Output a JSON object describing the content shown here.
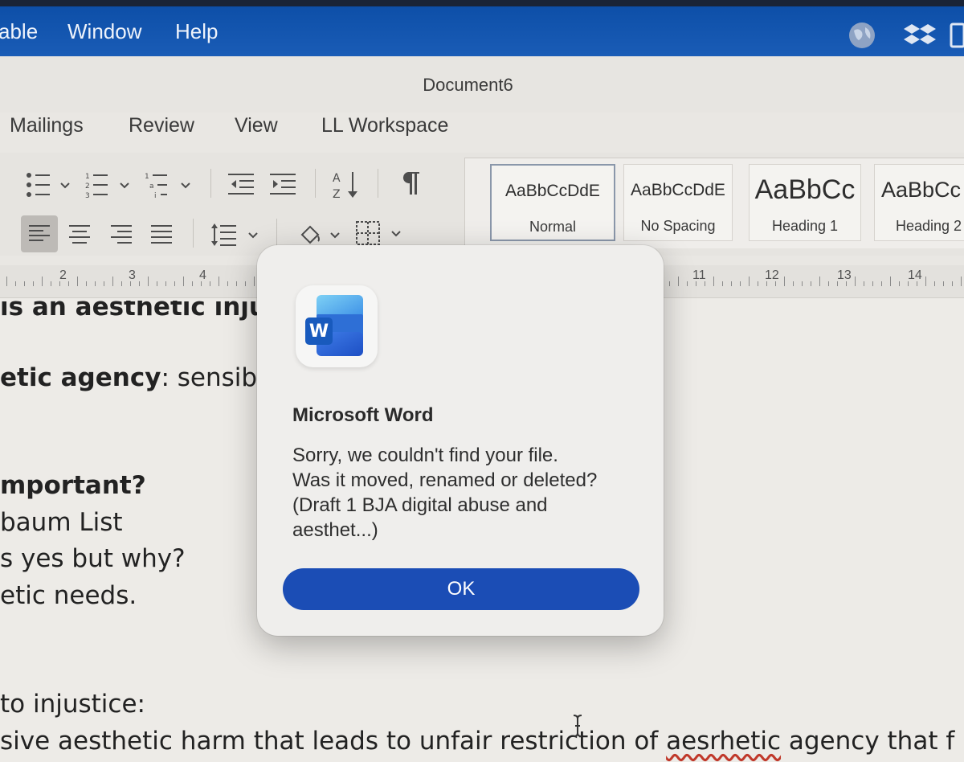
{
  "menubar": {
    "items": [
      "able",
      "Window",
      "Help"
    ],
    "tray_icons": [
      "globe-icon",
      "dropbox-icon",
      "clipboard-icon"
    ]
  },
  "window": {
    "title": "Document6"
  },
  "ribbon": {
    "tabs": [
      "Mailings",
      "Review",
      "View",
      "LL Workspace"
    ],
    "tools": [
      "bullets-icon",
      "numbering-icon",
      "multilevel-list-icon",
      "decrease-indent-icon",
      "increase-indent-icon",
      "sort-icon",
      "show-formatting-icon",
      "align-left-icon",
      "center-icon",
      "align-right-icon",
      "justify-icon",
      "line-spacing-icon",
      "shading-icon",
      "borders-icon"
    ],
    "styles": [
      {
        "sample": "AaBbCcDdE",
        "name": "Normal",
        "selected": true
      },
      {
        "sample": "AaBbCcDdE",
        "name": "No Spacing"
      },
      {
        "sample": "AaBbCc",
        "name": "Heading 1"
      },
      {
        "sample": "AaBbCc",
        "name": "Heading 2"
      }
    ]
  },
  "ruler": {
    "numbers": [
      "2",
      "3",
      "4",
      "11",
      "12",
      "13",
      "14"
    ]
  },
  "document": {
    "lines": [
      {
        "bold": "is an aesthetic inju",
        "rest": ""
      },
      {
        "bold": "etic agency",
        "rest": ": sensib"
      },
      {
        "bold": "mportant?",
        "rest": ""
      },
      {
        "bold": "",
        "rest": "baum List"
      },
      {
        "bold": "",
        "rest": "s yes but why?"
      },
      {
        "bold": "",
        "rest": "etic needs."
      },
      {
        "bold": "",
        "rest": " to injustice:"
      },
      {
        "bold": "",
        "rest": "sive aesthetic harm that leads to unfair restriction of ",
        "misspelled": "aesrhetic",
        "tail": " agency that f"
      }
    ]
  },
  "dialog": {
    "app_icon": "word-app-icon",
    "icon_letter": "W",
    "title": "Microsoft Word",
    "message": "Sorry, we couldn't find your file.\nWas it moved, renamed or deleted?\n(Draft 1 BJA digital abuse and\naesthet...)",
    "ok_label": "OK"
  },
  "colors": {
    "menubar": "#1a5cb6",
    "ok_button": "#1b4db5",
    "word_blue": "#185abd"
  }
}
